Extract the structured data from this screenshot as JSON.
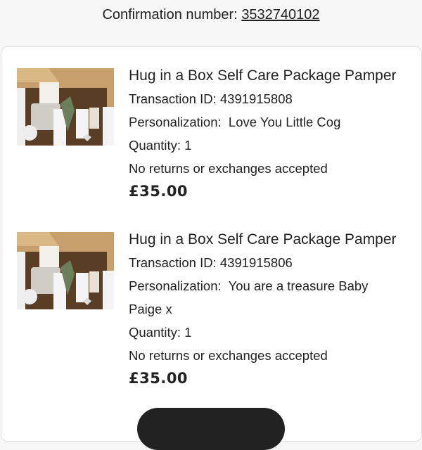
{
  "confirmation": {
    "label": "Confirmation number: ",
    "number": "3532740102"
  },
  "items": [
    {
      "title": "Hug in a Box Self Care Package Pamper",
      "transaction": "Transaction ID: 4391915808",
      "personalization_label": "Personalization:",
      "personalization_value": "Love You Little Cog",
      "quantity": "Quantity: 1",
      "returns": "No returns or exchanges accepted",
      "price": "£35.00",
      "image_icon": "gift-box-product-photo"
    },
    {
      "title": "Hug in a Box Self Care Package Pamper",
      "transaction": "Transaction ID: 4391915806",
      "personalization_label": "Personalization:",
      "personalization_value": "You are a treasure Baby Paige x",
      "quantity": "Quantity: 1",
      "returns": "No returns or exchanges accepted",
      "price": "£35.00",
      "image_icon": "gift-box-product-photo"
    }
  ],
  "colors": {
    "background": "#f6f6f6",
    "card": "#ffffff",
    "text": "#222222",
    "button": "#222222"
  }
}
